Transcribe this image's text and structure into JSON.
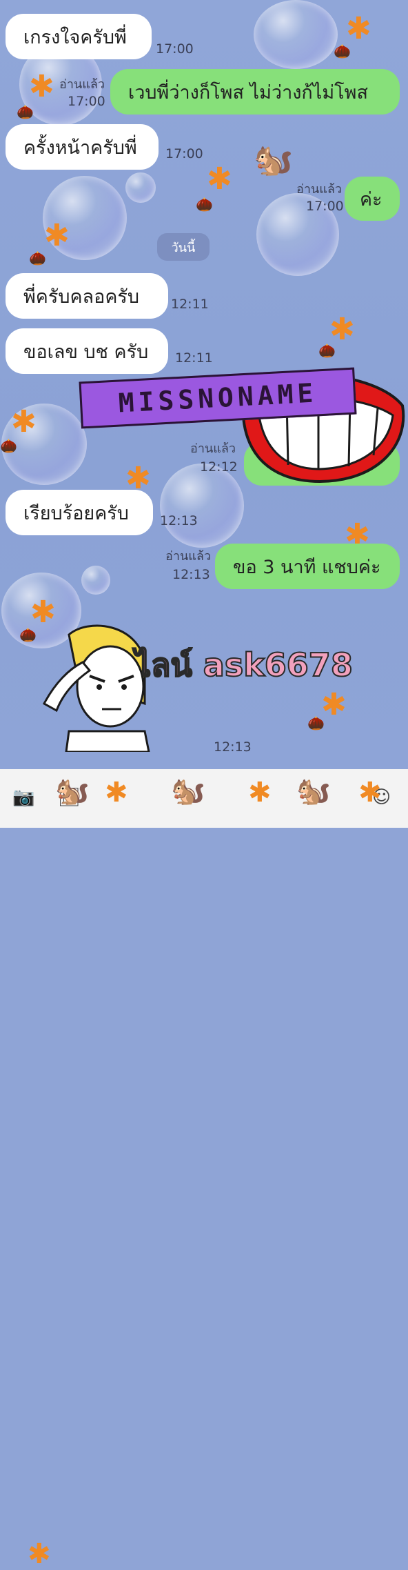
{
  "messages": [
    {
      "text": "เกรงใจครับพี่",
      "time": "17:00"
    },
    {
      "text": "เวบพี่ว่างก็โพส ไม่ว่างก้ไม่โพส",
      "read": "อ่านแล้ว",
      "time": "17:00"
    },
    {
      "text": "ครั้งหน้าครับพี่",
      "time": "17:00"
    },
    {
      "text": "ค่ะ",
      "read": "อ่านแล้ว",
      "time": "17:00"
    },
    {
      "text": "พี่ครับคลอครับ",
      "time": "12:11"
    },
    {
      "text": "ขอเลข บช ครับ",
      "time": "12:11"
    },
    {
      "text": "",
      "read": "อ่านแล้ว",
      "time": "12:12"
    },
    {
      "text": "เรียบร้อยครับ",
      "time": "12:13"
    },
    {
      "text": "ขอ 3 นาที แชบค่ะ",
      "read": "อ่านแล้ว",
      "time": "12:13"
    },
    {
      "text": "",
      "time": "12:13"
    }
  ],
  "date_separator": "วันนี้",
  "overlay": {
    "banner": "MISSNONAME",
    "contact": "ไลน์ ask6678"
  },
  "icons": {
    "camera": "camera-icon",
    "image": "image-icon",
    "emoji": "emoji-icon"
  },
  "colors": {
    "background": "#8fa4d6",
    "incoming_bubble": "#ffffff",
    "outgoing_bubble": "#87e07a",
    "banner": "#9b58e0"
  }
}
